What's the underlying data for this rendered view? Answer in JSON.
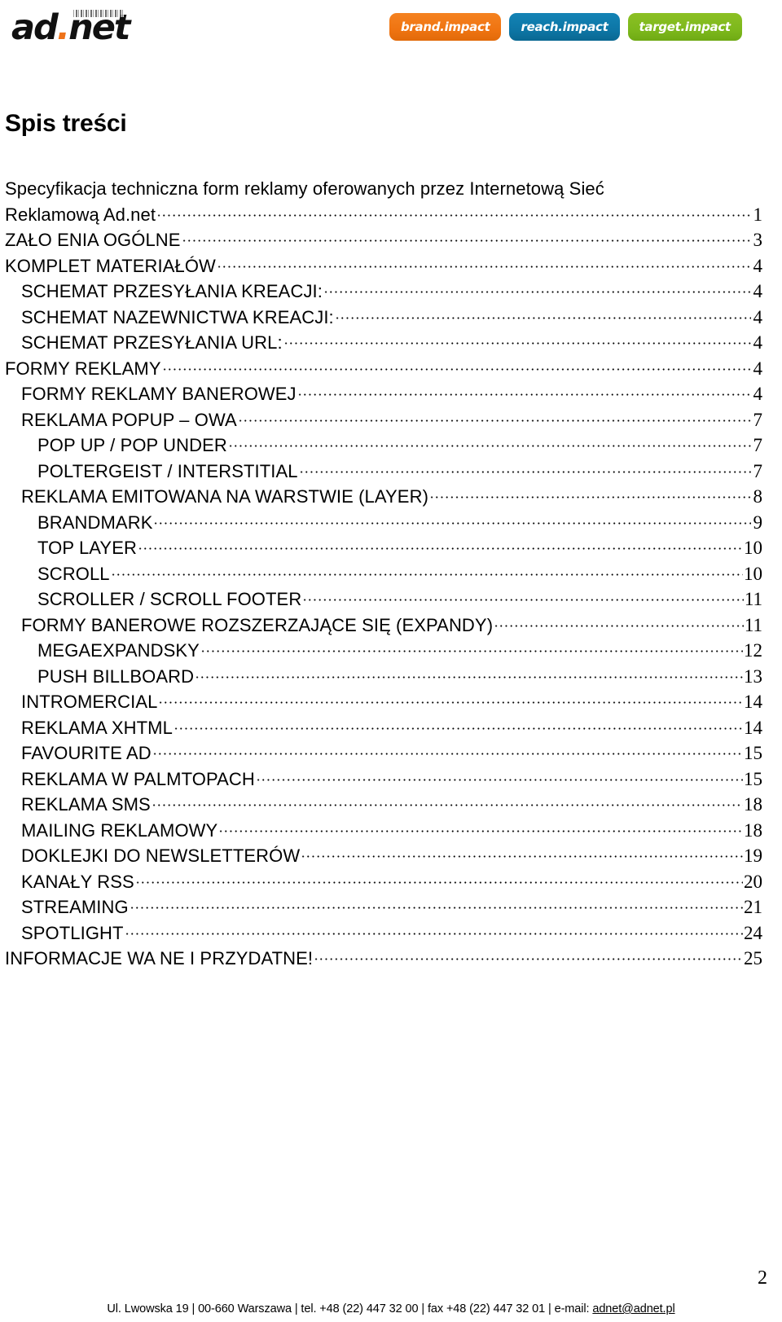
{
  "header": {
    "logo_text_part1": "ad",
    "logo_dot": ".",
    "logo_text_part2": "net",
    "badges": [
      {
        "label": "brand.impact",
        "color": "#f58220",
        "key": "brand"
      },
      {
        "label": "reach.impact",
        "color": "#1383b5",
        "key": "reach"
      },
      {
        "label": "target.impact",
        "color": "#8cc024",
        "key": "target"
      }
    ]
  },
  "title": "Spis treści",
  "toc": {
    "first_entry": {
      "line1": "Specyfikacja techniczna form reklamy oferowanych przez Internetową Sieć",
      "line2": "Reklamową Ad.net",
      "page": "1"
    },
    "entries": [
      {
        "label": "ZAŁO ENIA OGÓLNE",
        "page": "3",
        "level": 0
      },
      {
        "label": "KOMPLET MATERIAŁÓW",
        "page": "4",
        "level": 0
      },
      {
        "label": "SCHEMAT PRZESYŁANIA KREACJI:",
        "page": "4",
        "level": 1
      },
      {
        "label": "SCHEMAT NAZEWNICTWA KREACJI:",
        "page": "4",
        "level": 1
      },
      {
        "label": "SCHEMAT PRZESYŁANIA URL:",
        "page": "4",
        "level": 1
      },
      {
        "label": "FORMY REKLAMY",
        "page": "4",
        "level": 0
      },
      {
        "label": "FORMY REKLAMY BANEROWEJ",
        "page": "4",
        "level": 1
      },
      {
        "label": "REKLAMA POPUP – OWA",
        "page": "7",
        "level": 1
      },
      {
        "label": "POP UP / POP UNDER",
        "page": "7",
        "level": 2
      },
      {
        "label": "POLTERGEIST / INTERSTITIAL",
        "page": "7",
        "level": 2
      },
      {
        "label": "REKLAMA EMITOWANA NA WARSTWIE (LAYER)",
        "page": "8",
        "level": 1
      },
      {
        "label": "BRANDMARK",
        "page": "9",
        "level": 2
      },
      {
        "label": "TOP LAYER",
        "page": "10",
        "level": 2
      },
      {
        "label": "SCROLL",
        "page": "10",
        "level": 2
      },
      {
        "label": "SCROLLER / SCROLL FOOTER",
        "page": "11",
        "level": 2
      },
      {
        "label": "FORMY BANEROWE ROZSZERZAJĄCE SIĘ (EXPANDY)",
        "page": "11",
        "level": 1
      },
      {
        "label": "MEGAEXPANDSKY",
        "page": "12",
        "level": 2
      },
      {
        "label": "PUSH BILLBOARD",
        "page": "13",
        "level": 2
      },
      {
        "label": "INTROMERCIAL",
        "page": "14",
        "level": 1
      },
      {
        "label": "REKLAMA XHTML",
        "page": "14",
        "level": 1
      },
      {
        "label": "FAVOURITE AD",
        "page": "15",
        "level": 1
      },
      {
        "label": "REKLAMA W PALMTOPACH",
        "page": "15",
        "level": 1
      },
      {
        "label": "REKLAMA SMS",
        "page": "18",
        "level": 1
      },
      {
        "label": "MAILING REKLAMOWY",
        "page": "18",
        "level": 1
      },
      {
        "label": "DOKLEJKI DO NEWSLETTERÓW",
        "page": "19",
        "level": 1
      },
      {
        "label": "KANAŁY RSS",
        "page": "20",
        "level": 1
      },
      {
        "label": "STREAMING",
        "page": "21",
        "level": 1
      },
      {
        "label": "SPOTLIGHT",
        "page": "24",
        "level": 1
      },
      {
        "label": "INFORMACJE WA NE I PRZYDATNE!",
        "page": "25",
        "level": 0
      }
    ]
  },
  "footer": {
    "page_number": "2",
    "address": "Ul. Lwowska 19 | 00-660 Warszawa | tel. +48 (22) 447 32 00 | fax +48 (22) 447 32 01 | e-mail: ",
    "email": "adnet@adnet.pl"
  }
}
